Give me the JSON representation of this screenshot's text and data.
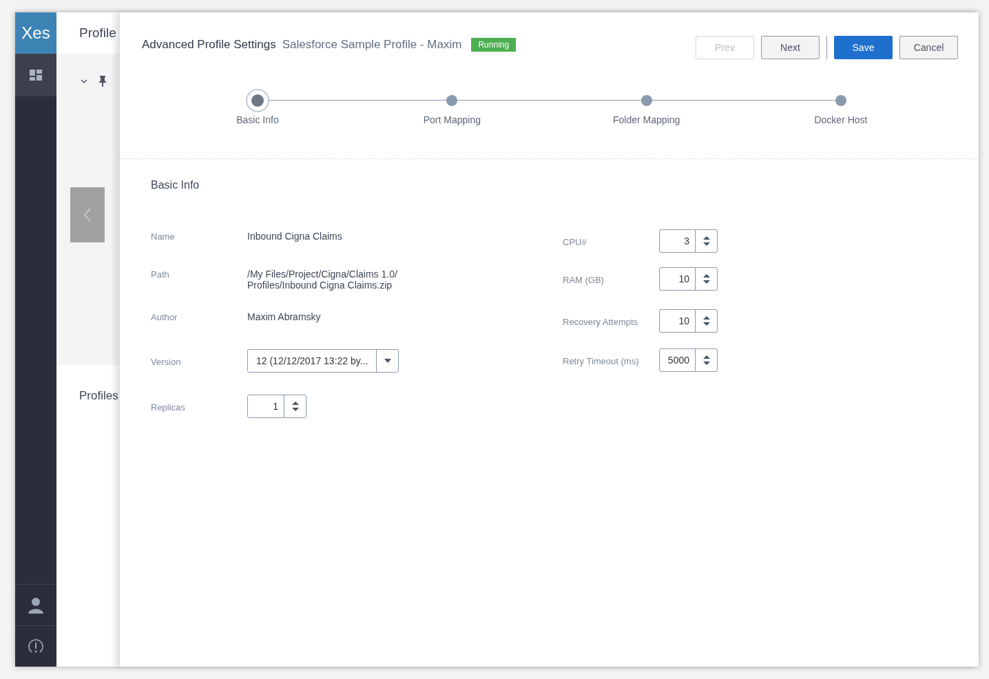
{
  "sidebar": {
    "logo": "Xes",
    "items": [
      {
        "kind": "dashboard",
        "selected": true
      }
    ],
    "bottom": [
      {
        "kind": "user"
      },
      {
        "kind": "alert"
      }
    ]
  },
  "background_page": {
    "title": "Profile",
    "section_title": "Profiles"
  },
  "panel": {
    "title": "Advanced Profile Settings",
    "subtitle": "Salesforce Sample Profile - Maxim",
    "status": "Running",
    "buttons": [
      {
        "label": "Prev",
        "kind": "secondary",
        "disabled": true
      },
      {
        "label": "Next",
        "kind": "secondary",
        "disabled": false
      },
      {
        "label": "Save",
        "kind": "primary",
        "disabled": false
      },
      {
        "label": "Cancel",
        "kind": "secondary",
        "disabled": false
      }
    ],
    "steps": [
      {
        "label": "Basic Info",
        "selected": true
      },
      {
        "label": "Port Mapping",
        "selected": false
      },
      {
        "label": "Folder Mapping",
        "selected": false
      },
      {
        "label": "Docker Host",
        "selected": false
      }
    ],
    "section_title": "Basic Info",
    "left_fields": [
      {
        "label": "Name",
        "kind": "text",
        "lines": [
          "Inbound Cigna Claims"
        ]
      },
      {
        "label": "Path",
        "kind": "text",
        "lines": [
          "/My Files/Project/Cigna/Claims 1.0/",
          "Profiles/Inbound Cigna Claims.zip"
        ]
      },
      {
        "label": "Author",
        "kind": "text",
        "lines": [
          "Maxim Abramsky"
        ]
      },
      {
        "label": "Version",
        "kind": "select",
        "value": "12 (12/12/2017 13:22 by..."
      },
      {
        "label": "Replicas",
        "kind": "spinner",
        "value": "1"
      }
    ],
    "right_fields": [
      {
        "label": "CPU#",
        "kind": "spinner",
        "value": "3"
      },
      {
        "label": "RAM (GB)",
        "kind": "spinner",
        "value": "10"
      },
      {
        "label": "Recovery Attempts",
        "kind": "spinner",
        "value": "10"
      },
      {
        "label": "Retry Timeout (ms)",
        "kind": "spinner",
        "value": "5000"
      }
    ]
  }
}
